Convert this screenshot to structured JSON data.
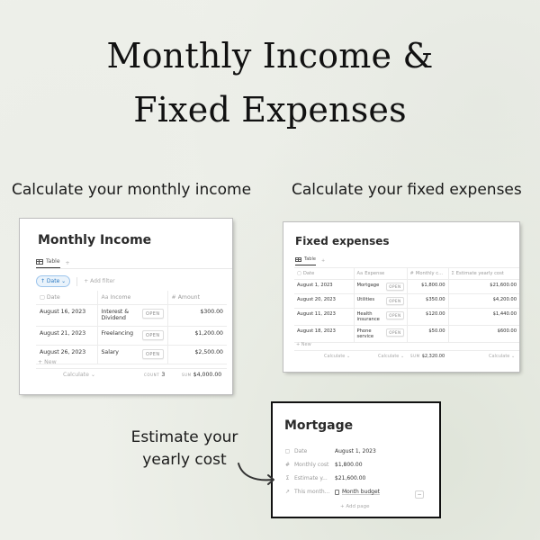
{
  "title": {
    "line1": "Monthly Income &",
    "line2": "Fixed Expenses"
  },
  "captions": {
    "income": "Calculate your monthly income",
    "expenses": "Calculate your fixed expenses",
    "estimate": "Estimate your yearly cost"
  },
  "income_panel": {
    "title": "Monthly Income",
    "tab_label": "Table",
    "add_view_icon": "+",
    "sort_chip": "↑ Date ⌄",
    "add_filter": "+ Add filter",
    "columns": [
      {
        "icon": "calendar-icon",
        "glyph": "▢",
        "label": "Date"
      },
      {
        "icon": "text-icon",
        "glyph": "Aa",
        "label": "Income"
      },
      {
        "icon": "number-icon",
        "glyph": "#",
        "label": "Amount"
      }
    ],
    "rows": [
      {
        "date": "August 16, 2023",
        "income": "Interest & Dividend",
        "open": "OPEN",
        "amount": "$300.00"
      },
      {
        "date": "August 21, 2023",
        "income": "Freelancing",
        "open": "OPEN",
        "amount": "$1,200.00"
      },
      {
        "date": "August 26, 2023",
        "income": "Salary",
        "open": "OPEN",
        "amount": "$2,500.00"
      }
    ],
    "new_label": "+ New",
    "footer": {
      "calculate": "Calculate ⌄",
      "count_label": "COUNT",
      "count_value": "3",
      "sum_label": "SUM",
      "sum_value": "$4,000.00"
    }
  },
  "expenses_panel": {
    "title": "Fixed expenses",
    "tab_label": "Table",
    "add_view_icon": "+",
    "columns": [
      {
        "icon": "calendar-icon",
        "glyph": "▢",
        "label": "Date"
      },
      {
        "icon": "text-icon",
        "glyph": "Aa",
        "label": "Expense"
      },
      {
        "icon": "number-icon",
        "glyph": "#",
        "label": "Monthly c..."
      },
      {
        "icon": "formula-icon",
        "glyph": "Σ",
        "label": "Estimate yearly cost"
      }
    ],
    "rows": [
      {
        "date": "August 1, 2023",
        "expense": "Mortgage",
        "open": "OPEN",
        "monthly": "$1,800.00",
        "yearly": "$21,600.00"
      },
      {
        "date": "August 20, 2023",
        "expense": "Utilities",
        "open": "OPEN",
        "monthly": "$350.00",
        "yearly": "$4,200.00"
      },
      {
        "date": "August 11, 2023",
        "expense": "Health insurance",
        "open": "OPEN",
        "monthly": "$120.00",
        "yearly": "$1,440.00"
      },
      {
        "date": "August 18, 2023",
        "expense": "Phone service",
        "open": "OPEN",
        "monthly": "$50.00",
        "yearly": "$600.00"
      }
    ],
    "new_label": "+ New",
    "footer": {
      "calc1": "Calculate ⌄",
      "calc2": "Calculate ⌄",
      "sum_label": "SUM",
      "sum_value": "$2,320.00",
      "calc4": "Calculate ⌄"
    }
  },
  "mortgage_panel": {
    "title": "Mortgage",
    "properties": [
      {
        "icon": "calendar-icon",
        "glyph": "▢",
        "key": "Date",
        "value": "August 1, 2023"
      },
      {
        "icon": "number-icon",
        "glyph": "#",
        "key": "Monthly cost",
        "value": "$1,800.00"
      },
      {
        "icon": "formula-icon",
        "glyph": "Σ",
        "key": "Estimate y...",
        "value": "$21,600.00"
      },
      {
        "icon": "relation-icon",
        "glyph": "↗",
        "key": "This month...",
        "value": "Month budget"
      }
    ],
    "remove_relation": "−",
    "add_page": "+ Add page"
  }
}
